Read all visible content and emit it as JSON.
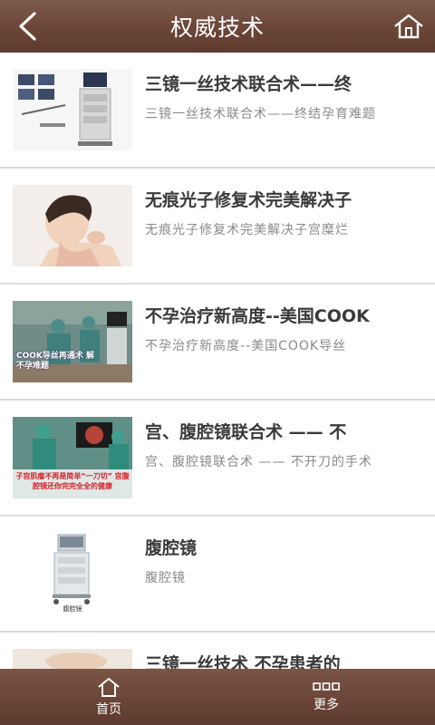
{
  "header": {
    "title": "权威技术",
    "back_icon": "chevron-left-icon",
    "home_icon": "home-icon"
  },
  "articles": [
    {
      "title": "三镜一丝技术联合术——终",
      "desc": "三镜一丝技术联合术——终结孕育难题",
      "thumb_icon": "endoscopy-equipment-image"
    },
    {
      "title": "无痕光子修复术完美解决子",
      "desc": "无痕光子修复术完美解决子宫糜烂",
      "thumb_icon": "woman-portrait-image"
    },
    {
      "title": "不孕治疗新高度--美国COOK",
      "desc": "不孕治疗新高度--美国COOK导丝",
      "thumb_icon": "surgery-room-image",
      "thumb_caption": "COOK导丝再通术 解不孕难题"
    },
    {
      "title": "宫、腹腔镜联合术 —— 不",
      "desc": "宫、腹腔镜联合术 —— 不开刀的手术",
      "thumb_icon": "laparoscopy-surgery-image",
      "thumb_caption": "子宫肌瘤不再是简单“一刀切” 宫腹腔镜还你完完全全的健康"
    },
    {
      "title": "腹腔镜",
      "desc": "腹腔镜",
      "thumb_icon": "laparoscope-cart-image",
      "thumb_caption": "腹腔镜"
    },
    {
      "title": "三镜一丝技术 不孕患者的",
      "desc": "",
      "thumb_icon": "partial-image"
    }
  ],
  "tabbar": [
    {
      "label": "首页",
      "icon": "home-icon"
    },
    {
      "label": "更多",
      "icon": "more-grid-icon"
    }
  ],
  "colors": {
    "header_brown": "#6b4638",
    "title_text": "#3a3a3a",
    "desc_text": "#8a8a8a"
  }
}
